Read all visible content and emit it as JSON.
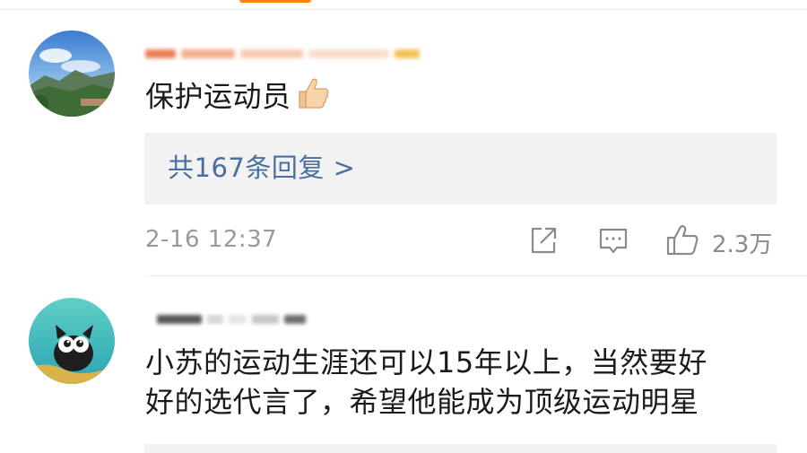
{
  "comments": [
    {
      "text": "保护运动员",
      "replies_label": "共167条回复 >",
      "timestamp": "2-16 12:37",
      "likes": "2.3万"
    },
    {
      "text_line1": "小苏的运动生涯还可以15年以上，当然要好",
      "text_line2": "好的选代言了，希望他能成为顶级运动明星"
    }
  ],
  "colors": {
    "accent": "#ff8200",
    "link": "#4a6f9e",
    "meta": "#9a9a9a",
    "reply_bg": "#f2f2f2"
  },
  "icons": [
    "thumbs-up-emoji",
    "share-icon",
    "comment-icon",
    "like-icon"
  ]
}
